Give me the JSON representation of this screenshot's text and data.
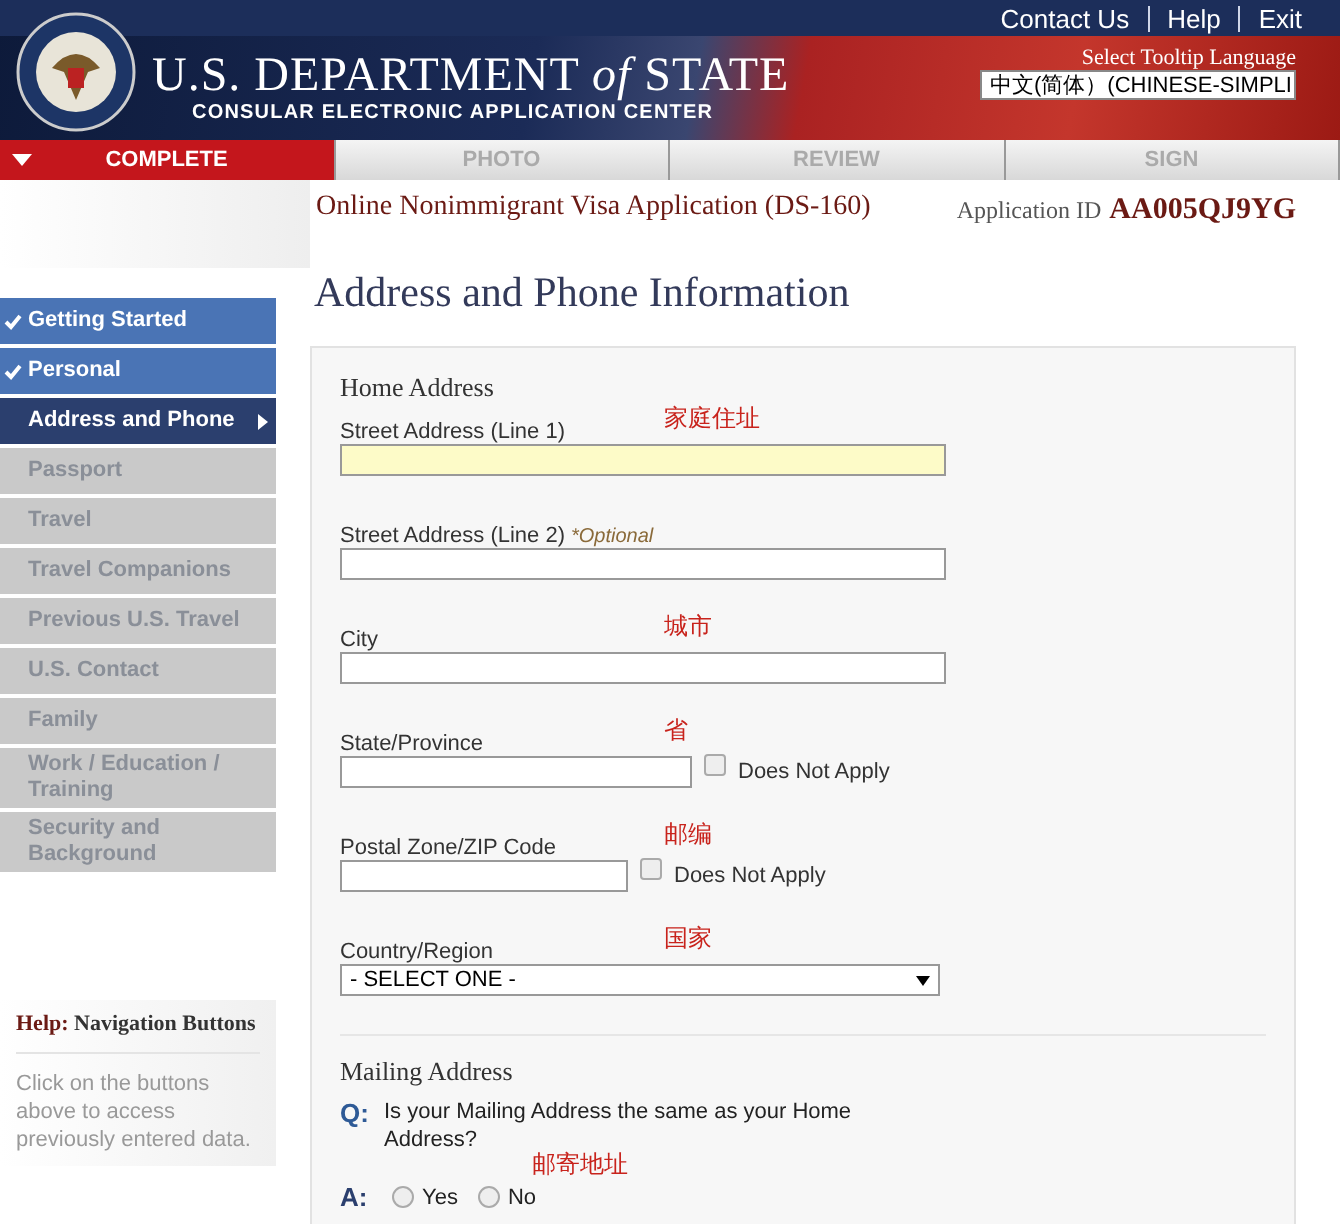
{
  "top_links": [
    "Contact Us",
    "Help",
    "Exit"
  ],
  "header": {
    "title": "U.S. DEPARTMENT *of* STATE",
    "subtitle": "CONSULAR ELECTRONIC APPLICATION CENTER",
    "language_label": "Select Tooltip Language",
    "language_value": "中文(简体）(CHINESE-SIMPLI"
  },
  "tabs": [
    {
      "label": "COMPLETE",
      "selected": true
    },
    {
      "label": "PHOTO",
      "selected": false
    },
    {
      "label": "REVIEW",
      "selected": false
    },
    {
      "label": "SIGN",
      "selected": false
    }
  ],
  "application": {
    "title": "Online Nonimmigrant Visa Application (DS-160)",
    "id_label": "Application ID",
    "id_value": "AA005QJ9YG"
  },
  "sidebar": {
    "items": [
      {
        "label": "Getting Started",
        "completed": true,
        "selected": false
      },
      {
        "label": "Personal",
        "completed": true,
        "selected": false
      },
      {
        "label": "Address and Phone",
        "completed": false,
        "selected": true
      },
      {
        "label": "Passport",
        "completed": false,
        "selected": false
      },
      {
        "label": "Travel",
        "completed": false,
        "selected": false
      },
      {
        "label": "Travel Companions",
        "completed": false,
        "selected": false
      },
      {
        "label": "Previous U.S. Travel",
        "completed": false,
        "selected": false
      },
      {
        "label": "U.S. Contact",
        "completed": false,
        "selected": false
      },
      {
        "label": "Family",
        "completed": false,
        "selected": false
      },
      {
        "label": "Work / Education / Training",
        "completed": false,
        "selected": false
      },
      {
        "label": "Security and Background",
        "completed": false,
        "selected": false
      }
    ],
    "help_title": "**Help:** Navigation Buttons",
    "help_text": "Click on the buttons above to access previously entered data."
  },
  "page_title": "Address and Phone Information",
  "home_address": {
    "heading": "Home Address",
    "fields": [
      {
        "kind": "text",
        "label": "Street Address (Line 1)",
        "note": "家庭住址",
        "focused": true
      },
      {
        "kind": "text",
        "label": "Street Address (Line 2)",
        "optional": "*Optional",
        "focused": false
      },
      {
        "kind": "text",
        "label": "City",
        "note": "城市",
        "focused": false
      },
      {
        "kind": "text",
        "label": "State/Province",
        "note": "省",
        "focused": false,
        "does_not_apply": {
          "label": "Does Not Apply",
          "checked": false
        }
      },
      {
        "kind": "text",
        "label": "Postal Zone/ZIP Code",
        "note": "邮编",
        "focused": false,
        "does_not_apply": {
          "label": "Does Not Apply",
          "checked": false
        }
      },
      {
        "kind": "select",
        "label": "Country/Region",
        "note": "国家",
        "value": "- SELECT ONE -"
      }
    ]
  },
  "mailing_address": {
    "heading": "Mailing Address",
    "q_mark": "Q:",
    "question": "Is your Mailing Address the same as your Home Address?",
    "note": "邮寄地址",
    "a_mark": "A:",
    "options": [
      {
        "label": "Yes",
        "selected": false
      },
      {
        "label": "No",
        "selected": false
      }
    ]
  }
}
